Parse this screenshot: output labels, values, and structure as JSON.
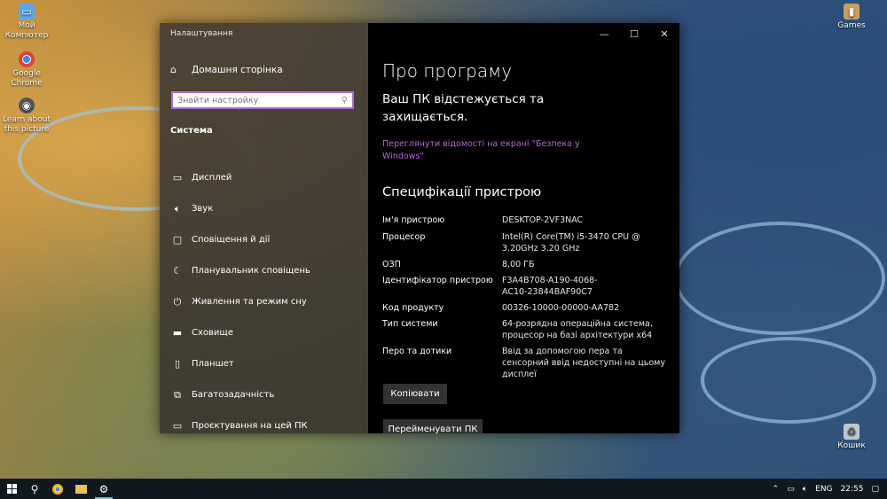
{
  "desktop": {
    "icons": [
      {
        "label": "Мой Компютер",
        "icon": "computer-icon"
      },
      {
        "label": "Google Chrome",
        "icon": "chrome-icon"
      },
      {
        "label": "Learn about this picture",
        "icon": "camera-icon"
      },
      {
        "label": "Games",
        "icon": "games-folder-icon"
      },
      {
        "label": "Кошик",
        "icon": "recycle-bin-icon"
      }
    ]
  },
  "window": {
    "app_title": "Налаштування",
    "home_label": "Домашня сторінка",
    "search_placeholder": "Знайти настройку",
    "section_label": "Система",
    "nav_items": [
      {
        "label": "Дисплей",
        "icon": "display-icon"
      },
      {
        "label": "Звук",
        "icon": "sound-icon"
      },
      {
        "label": "Сповіщення й дії",
        "icon": "notifications-icon"
      },
      {
        "label": "Планувальник сповіщень",
        "icon": "moon-icon"
      },
      {
        "label": "Живлення та режим сну",
        "icon": "power-icon"
      },
      {
        "label": "Сховище",
        "icon": "storage-icon"
      },
      {
        "label": "Планшет",
        "icon": "tablet-icon"
      },
      {
        "label": "Багатозадачність",
        "icon": "multitasking-icon"
      },
      {
        "label": "Проєктування на цей ПК",
        "icon": "projecting-icon"
      }
    ],
    "controls": {
      "minimize": "—",
      "maximize": "☐",
      "close": "✕"
    }
  },
  "about": {
    "title": "Про програму",
    "protection_text": "Ваш ПК відстежується та захищається.",
    "security_link": "Переглянути відомості на екрані \"Безпека у Windows\"",
    "specs_title": "Специфікації пристрою",
    "specs": [
      {
        "key": "Ім'я пристрою",
        "value": "DESKTOP-2VF3NAC"
      },
      {
        "key": "Процесор",
        "value": "Intel(R) Core(TM) i5-3470 CPU @ 3.20GHz   3.20 GHz"
      },
      {
        "key": "ОЗП",
        "value": "8,00 ГБ"
      },
      {
        "key": "Ідентифікатор пристрою",
        "value": "F3A4B708-A190-4068-AC10-23844BAF90C7"
      },
      {
        "key": "Код продукту",
        "value": "00326-10000-00000-AA782"
      },
      {
        "key": "Тип системи",
        "value": "64-розрядна операційна система, процесор на базі архітектури x64"
      },
      {
        "key": "Перо та дотики",
        "value": "Ввід за допомогою пера та сенсорний ввід недоступні на цьому дисплеї"
      }
    ],
    "copy_button": "Копіювати",
    "rename_button": "Перейменувати ПК"
  },
  "taskbar": {
    "language": "ENG",
    "time": "22:55"
  }
}
